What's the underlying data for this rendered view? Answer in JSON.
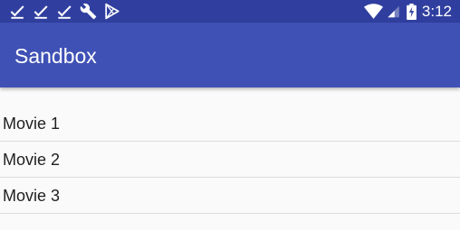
{
  "status_bar": {
    "notification_icons": [
      "check-icon",
      "check-icon",
      "check-icon",
      "wrench-icon",
      "play-store-icon"
    ],
    "system_icons": [
      "wifi-icon",
      "cell-signal-icon",
      "battery-charging-icon"
    ],
    "time": "3:12"
  },
  "app_bar": {
    "title": "Sandbox"
  },
  "movies": [
    {
      "label": "Movie 1"
    },
    {
      "label": "Movie 2"
    },
    {
      "label": "Movie 3"
    }
  ],
  "colors": {
    "status_bar": "#303f9f",
    "app_bar": "#3f51b5",
    "background": "#fafafa",
    "divider": "#dcdcdc"
  }
}
